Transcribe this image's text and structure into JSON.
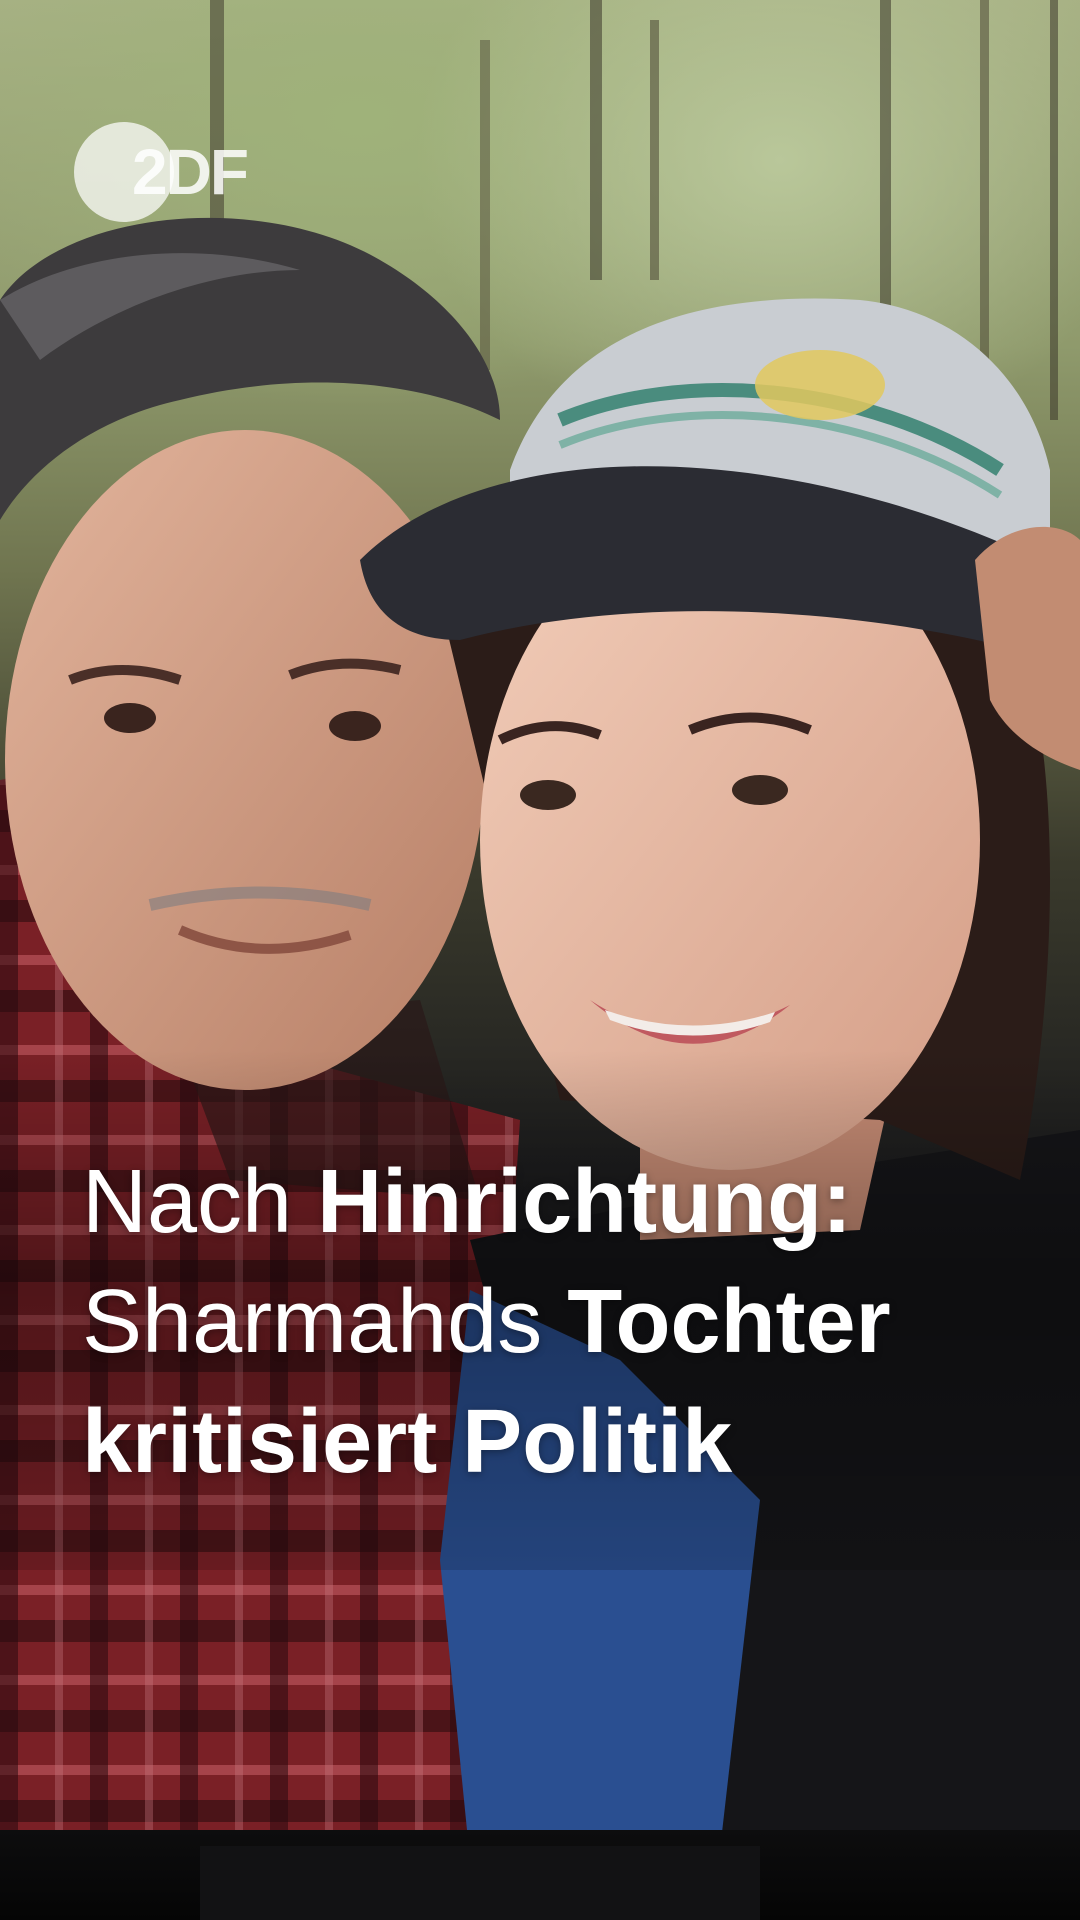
{
  "logo": {
    "text": "2DF",
    "icon": "zdf-logo-icon"
  },
  "headline": {
    "line1": {
      "regular": "Nach ",
      "bold": "Hinrichtung:"
    },
    "line2": {
      "regular": "Sharmahds ",
      "bold": "Tochter"
    },
    "line3": {
      "bold": "kritisiert Politik"
    }
  },
  "colors": {
    "headline_text": "#ffffff",
    "cap": "#c9cdd2",
    "cap_brim": "#2b2c33",
    "shirt_blue": "#2a4f91",
    "shirt_red": "#8c2a2f"
  }
}
